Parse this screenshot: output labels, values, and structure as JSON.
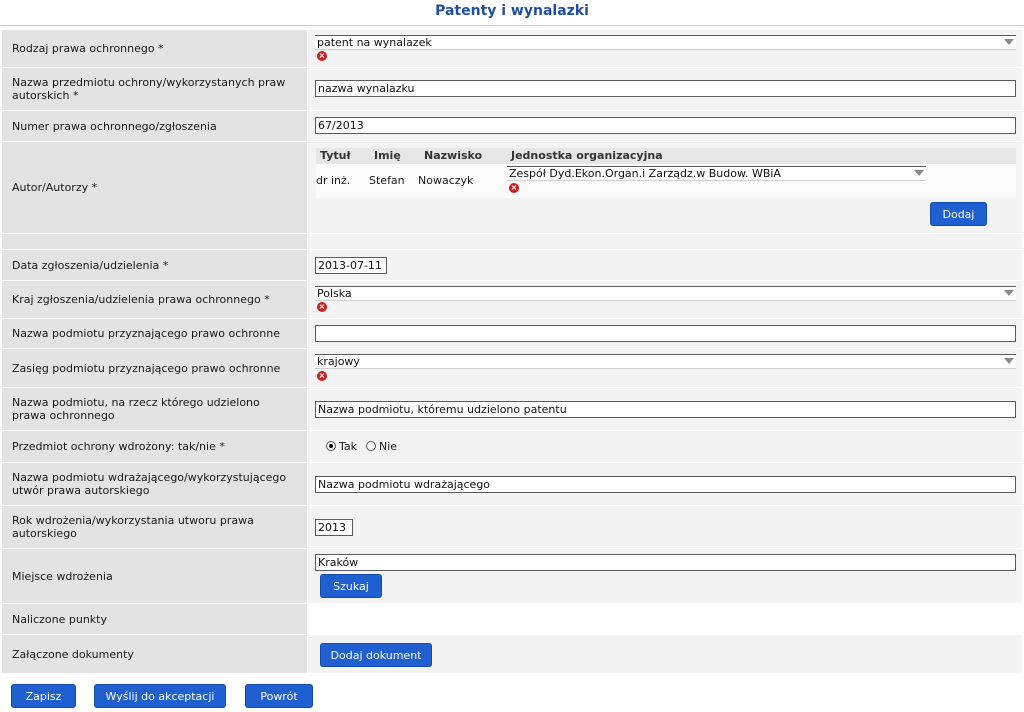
{
  "page": {
    "title": "Patenty i wynalazki"
  },
  "fields": {
    "rodzaj": {
      "label": "Rodzaj prawa ochronnego *",
      "value": "patent na wynalazek"
    },
    "nazwa_przedmiotu": {
      "label": "Nazwa przedmiotu ochrony/wykorzystanych praw autorskich *",
      "value": "nazwa wynalazku"
    },
    "numer": {
      "label": "Numer prawa ochronnego/zgłoszenia",
      "value": "67/2013"
    },
    "autorzy": {
      "label": "Autor/Autorzy *",
      "columns": [
        "Tytuł",
        "Imię",
        "Nazwisko",
        "Jednostka organizacyjna"
      ],
      "rows": [
        {
          "tytul": "dr inż.",
          "imie": "Stefan",
          "nazwisko": "Nowaczyk",
          "jednostka": "Zespół Dyd.Ekon.Organ.i Zarządz.w Budow. WBiA"
        }
      ],
      "add_label": "Dodaj"
    },
    "data": {
      "label": "Data zgłoszenia/udzielenia *",
      "value": "2013-07-11"
    },
    "kraj": {
      "label": "Kraj zgłoszenia/udzielenia prawa ochronnego *",
      "value": "Polska"
    },
    "podmiot_przyznajacy": {
      "label": "Nazwa podmiotu przyznającego prawo ochronne",
      "value": ""
    },
    "zasieg": {
      "label": "Zasięg podmiotu przyznającego prawo ochronne",
      "value": "krajowy"
    },
    "podmiot_udzielono": {
      "label": "Nazwa podmiotu, na rzecz którego udzielono prawa ochronnego",
      "value": "Nazwa podmiotu, któremu udzielono patentu"
    },
    "wdrozony": {
      "label": "Przedmiot ochrony wdrożony: tak/nie  *",
      "options": [
        "Tak",
        "Nie"
      ],
      "selected": "Tak"
    },
    "podmiot_wdrazajacy": {
      "label": "Nazwa podmiotu wdrażającego/wykorzystującego utwór prawa autorskiego",
      "value": "Nazwa podmiotu wdrażającego"
    },
    "rok": {
      "label": "Rok wdrożenia/wykorzystania utworu prawa autorskiego",
      "value": "2013"
    },
    "miejsce": {
      "label": "Miejsce wdrożenia",
      "value": "Kraków",
      "search_label": "Szukaj"
    },
    "punkty": {
      "label": "Naliczone punkty",
      "value": ""
    },
    "dokumenty": {
      "label": "Załączone dokumenty",
      "add_label": "Dodaj dokument"
    }
  },
  "actions": {
    "save": "Zapisz",
    "send": "Wyślij do akceptacji",
    "back": "Powrót"
  },
  "colors": {
    "title": "#1f4f9e",
    "button": "#1f5fcf",
    "label_bg": "#e3e3e3",
    "value_bg": "#f3f3f3",
    "clear": "#cc1f1f"
  },
  "icons": {
    "clear": "clear-icon",
    "dropdown": "chevron-down-icon"
  }
}
